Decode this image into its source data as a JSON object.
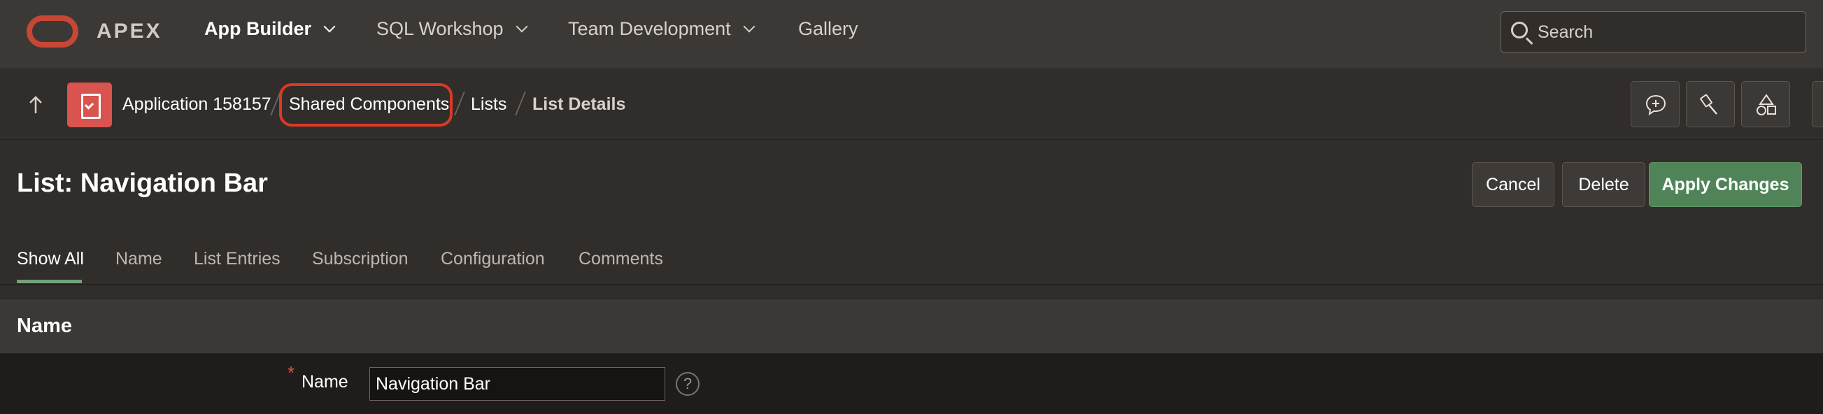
{
  "topnav": {
    "brand": "APEX",
    "items": [
      {
        "label": "App Builder",
        "has_menu": true
      },
      {
        "label": "SQL Workshop",
        "has_menu": true
      },
      {
        "label": "Team Development",
        "has_menu": true
      },
      {
        "label": "Gallery",
        "has_menu": false
      }
    ],
    "search": {
      "placeholder": "Search",
      "icon": "search-icon"
    }
  },
  "breadcrumb": {
    "items": [
      "Application 158157",
      "Shared Components",
      "Lists"
    ],
    "current": "List Details"
  },
  "toolbar": {
    "icons": [
      "comment-add-icon",
      "brush-icon",
      "shapes-icon"
    ]
  },
  "page": {
    "title": "List: Navigation Bar",
    "buttons": {
      "cancel": "Cancel",
      "delete": "Delete",
      "apply": "Apply Changes"
    }
  },
  "tabs": [
    "Show All",
    "Name",
    "List Entries",
    "Subscription",
    "Configuration",
    "Comments"
  ],
  "region": {
    "title": "Name",
    "field": {
      "label": "Name",
      "value": "Navigation Bar",
      "required_marker": "*",
      "help": "?"
    }
  },
  "colors": {
    "accent_red": "#c74634",
    "highlight": "#d93a26",
    "primary_button": "#508458"
  }
}
